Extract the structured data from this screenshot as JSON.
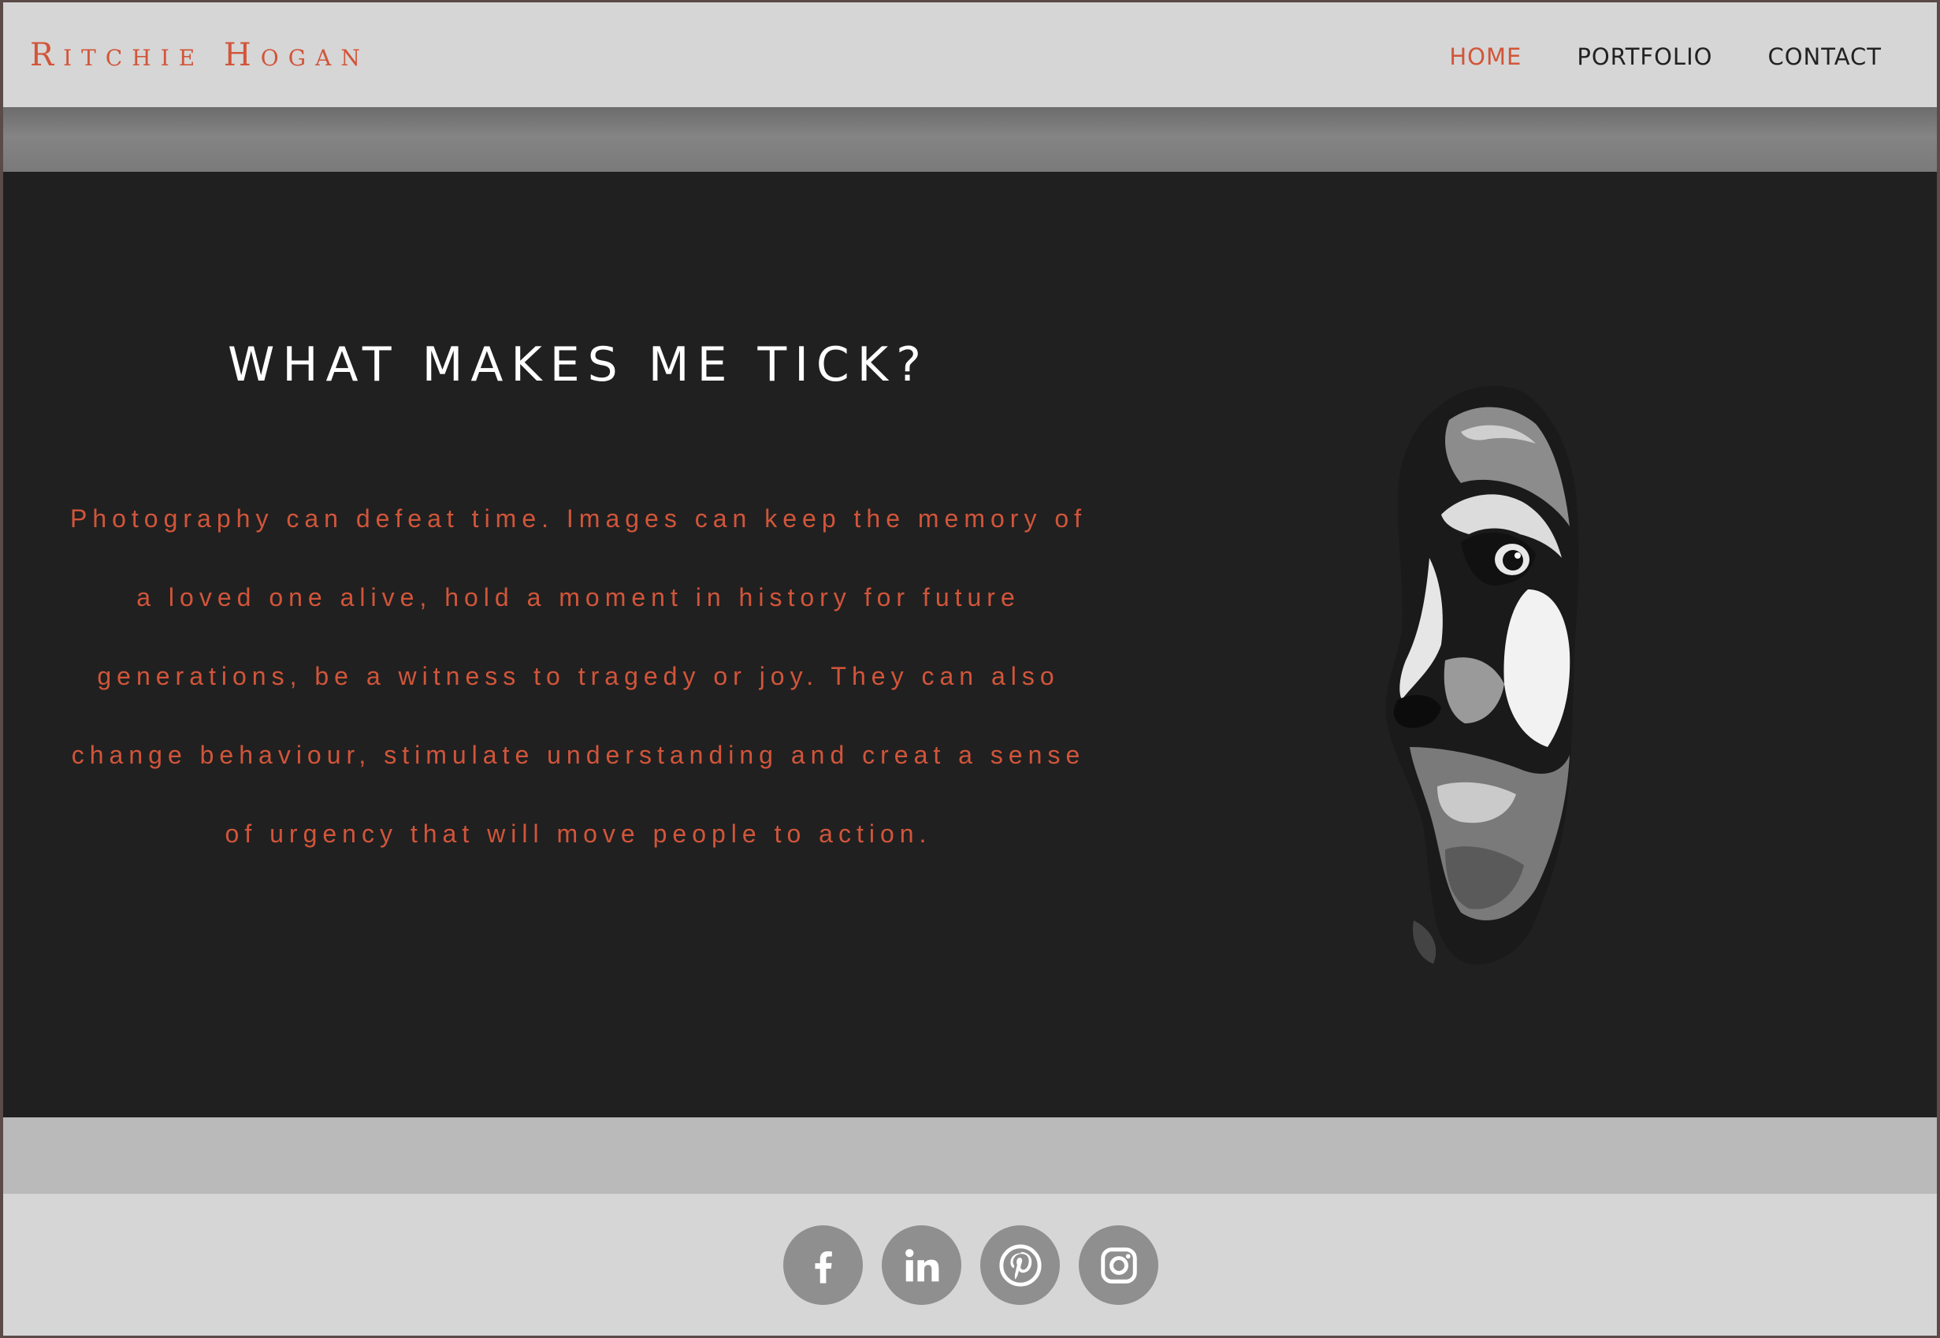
{
  "header": {
    "logo": "Ritchie Hogan",
    "nav": [
      {
        "label": "HOME",
        "active": true
      },
      {
        "label": "PORTFOLIO",
        "active": false
      },
      {
        "label": "CONTACT",
        "active": false
      }
    ]
  },
  "main": {
    "heading": "WHAT MAKES ME TICK?",
    "paragraph": "Photography can defeat time. Images can keep the memory of a loved one alive, hold a moment in history for future generations, be a witness to tragedy or joy. They can also change behaviour, stimulate understanding and creat a sense of urgency that will move people to action."
  },
  "footer": {
    "social": [
      {
        "name": "facebook-icon"
      },
      {
        "name": "linkedin-icon"
      },
      {
        "name": "pinterest-icon"
      },
      {
        "name": "instagram-icon"
      }
    ]
  },
  "colors": {
    "accent": "#d2553a",
    "header_bg": "#d6d6d6",
    "main_bg": "#202020",
    "icon_bg": "#8f8f8f"
  }
}
